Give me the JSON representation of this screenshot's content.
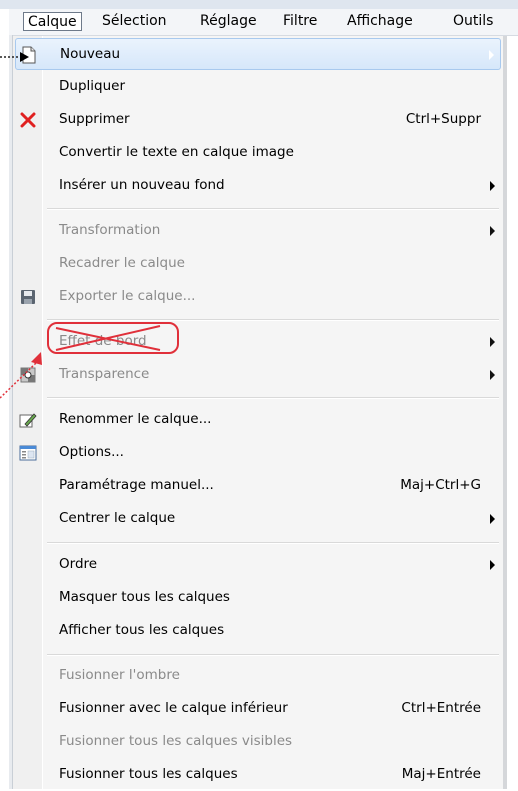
{
  "menubar": {
    "items": [
      {
        "label": "Calque",
        "active": true
      },
      {
        "label": "Sélection"
      },
      {
        "label": "Réglage"
      },
      {
        "label": "Filtre"
      },
      {
        "label": "Affichage"
      },
      {
        "label": "Outils"
      }
    ]
  },
  "menu": {
    "items": [
      {
        "label": "Nouveau",
        "submenu": true,
        "highlighted": true,
        "icon": "new-page-icon"
      },
      {
        "label": "Dupliquer"
      },
      {
        "label": "Supprimer",
        "shortcut": "Ctrl+Suppr",
        "icon": "red-x-icon"
      },
      {
        "label": "Convertir le texte en calque image"
      },
      {
        "label": "Insérer un nouveau fond",
        "submenu": true
      },
      {
        "label": "Transformation",
        "submenu": true,
        "disabled": true
      },
      {
        "label": "Recadrer le calque",
        "disabled": true
      },
      {
        "label": "Exporter le calque...",
        "disabled": true,
        "icon": "floppy-disk-icon"
      },
      {
        "label": "Effet de bord",
        "submenu": true,
        "disabled": true
      },
      {
        "label": "Transparence",
        "submenu": true,
        "disabled": true,
        "icon": "transparency-icon"
      },
      {
        "label": "Renommer le calque...",
        "icon": "rename-pencil-icon"
      },
      {
        "label": "Options...",
        "icon": "options-window-icon"
      },
      {
        "label": "Paramétrage manuel...",
        "shortcut": "Maj+Ctrl+G"
      },
      {
        "label": "Centrer le calque",
        "submenu": true
      },
      {
        "label": "Ordre",
        "submenu": true
      },
      {
        "label": "Masquer tous les calques"
      },
      {
        "label": "Afficher tous les calques"
      },
      {
        "label": "Fusionner l'ombre",
        "disabled": true
      },
      {
        "label": "Fusionner avec le calque inférieur",
        "shortcut": "Ctrl+Entrée"
      },
      {
        "label": "Fusionner tous les calques visibles",
        "disabled": true
      },
      {
        "label": "Fusionner tous les calques",
        "shortcut": "Maj+Entrée"
      }
    ]
  },
  "colors": {
    "highlight": "#d6e7fa",
    "annotation": "#e0303a",
    "disabled_text": "#8a8a8a"
  }
}
